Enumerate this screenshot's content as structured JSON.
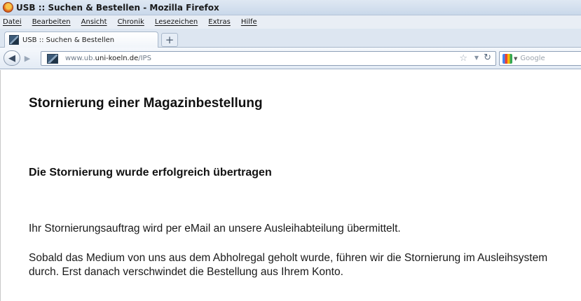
{
  "window": {
    "title": "USB :: Suchen & Bestellen - Mozilla Firefox"
  },
  "menu": {
    "items": [
      "Datei",
      "Bearbeiten",
      "Ansicht",
      "Chronik",
      "Lesezeichen",
      "Extras",
      "Hilfe"
    ]
  },
  "tabs": {
    "active_label": "USB :: Suchen & Bestellen",
    "new_tab_symbol": "+"
  },
  "navigation": {
    "url_prefix": "www.ub.",
    "url_domain": "uni-koeln.de",
    "url_path": "/IPS",
    "search_placeholder": "Google"
  },
  "page": {
    "title": "Stornierung einer Magazinbestellung",
    "subtitle": "Die Stornierung wurde erfolgreich übertragen",
    "paragraph_1": "Ihr Stornierungsauftrag wird per eMail an unsere Ausleihabteilung übermittelt.",
    "paragraph_2": "Sobald das Medium von uns aus dem Abholregal geholt wurde, führen wir die Stornierung im Ausleihsystem durch. Erst danach verschwindet die Bestellung aus Ihrem Konto."
  },
  "icons": {
    "browser": "firefox-icon",
    "back": "back-arrow-icon",
    "forward": "forward-arrow-icon",
    "bookmark": "star-icon",
    "reload": "reload-icon",
    "search_engine": "google-icon"
  }
}
